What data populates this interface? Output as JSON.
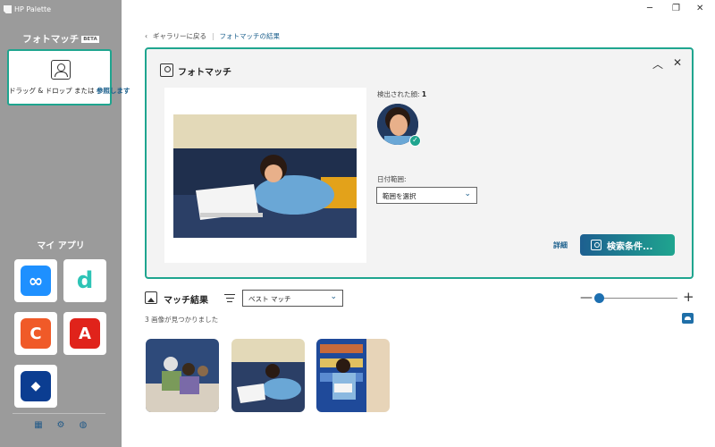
{
  "app": {
    "title": "HP Palette"
  },
  "sidebar": {
    "heading": "フォトマッチ",
    "badge": "BETA",
    "drop_text": "ドラッグ & ドロップ または",
    "drop_link": "参照します",
    "myapps_title": "マイ アプリ",
    "apps": [
      {
        "name": "infinity-app",
        "glyph": "∞",
        "color": "#1e90ff"
      },
      {
        "name": "d-app",
        "glyph": "d",
        "color": "#2ec4b6"
      },
      {
        "name": "orange-app",
        "glyph": "C",
        "color": "#f05a28"
      },
      {
        "name": "adobe-app",
        "glyph": "A",
        "color": "#e0231b"
      },
      {
        "name": "dropbox-app",
        "glyph": "◆",
        "color": "#0b3d91"
      }
    ]
  },
  "breadcrumb": {
    "back": "ギャラリーに戻る",
    "current": "フォトマッチの結果"
  },
  "panel": {
    "title": "フォトマッチ",
    "faces_label": "検出された顔:",
    "faces_count": "1",
    "date_label": "日付範囲:",
    "date_value": "範囲を選択",
    "detail_link": "詳細",
    "search_button": "検索条件..."
  },
  "results": {
    "title": "マッチ結果",
    "sort_value": "ベスト マッチ",
    "count_text": "3 画像が見つかりました",
    "zoom_level": 0.05
  },
  "colors": {
    "accent": "#1fa58f",
    "primary": "#1d5f90"
  }
}
